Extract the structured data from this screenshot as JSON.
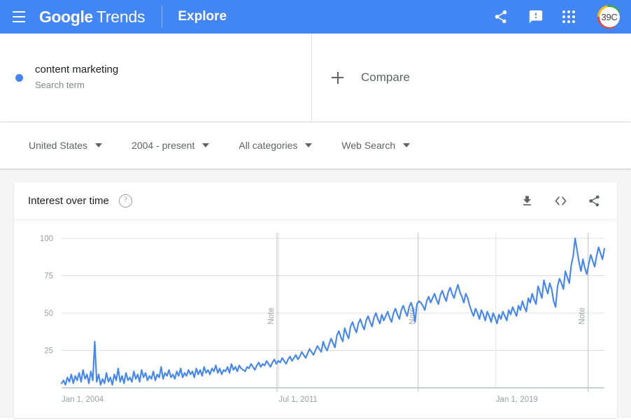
{
  "topbar": {
    "menu_icon": "hamburger-icon",
    "brand_google": "Google",
    "brand_product": "Trends",
    "explore_label": "Explore",
    "share_icon": "share-icon",
    "feedback_icon": "feedback-icon",
    "apps_icon": "apps-grid-icon",
    "avatar_text": "39C",
    "bg_color": "#4285F4"
  },
  "query": {
    "term_label": "content marketing",
    "term_type": "Search term",
    "term_color": "#4285F4",
    "compare_label": "Compare",
    "compare_icon": "plus-icon"
  },
  "filters": [
    {
      "label": "United States",
      "name": "location-filter"
    },
    {
      "label": "2004 - present",
      "name": "time-range-filter"
    },
    {
      "label": "All categories",
      "name": "category-filter"
    },
    {
      "label": "Web Search",
      "name": "search-type-filter"
    }
  ],
  "card": {
    "title": "Interest over time",
    "help_icon": "help-circle-icon",
    "help_glyph": "?",
    "download_icon": "download-icon",
    "embed_icon": "embed-code-icon",
    "share_icon": "share-icon"
  },
  "chart_data": {
    "type": "line",
    "title": "Interest over time",
    "xlabel": "",
    "ylabel": "",
    "ylim": [
      0,
      100
    ],
    "yticks": [
      100,
      75,
      50,
      25
    ],
    "grid": true,
    "legend": false,
    "line_color": "#4285F4",
    "xticks": [
      {
        "label": "Jan 1, 2004",
        "x_frac": 0.0
      },
      {
        "label": "Jul 1, 2011",
        "x_frac": 0.4
      },
      {
        "label": "Jan 1, 2019",
        "x_frac": 0.8
      }
    ],
    "annotations": [
      {
        "label": "Note",
        "x_frac": 0.397
      },
      {
        "label": "Note",
        "x_frac": 0.657
      },
      {
        "label": "Note",
        "x_frac": 0.97
      }
    ],
    "series": [
      {
        "name": "content marketing",
        "color": "#4285F4",
        "values": [
          3,
          5,
          2,
          7,
          4,
          9,
          3,
          8,
          5,
          10,
          4,
          12,
          6,
          9,
          3,
          11,
          5,
          31,
          4,
          9,
          2,
          6,
          3,
          10,
          4,
          7,
          2,
          9,
          5,
          13,
          4,
          8,
          3,
          10,
          5,
          7,
          4,
          11,
          6,
          9,
          4,
          12,
          7,
          10,
          5,
          8,
          6,
          11,
          5,
          9,
          7,
          14,
          6,
          10,
          8,
          12,
          7,
          9,
          6,
          11,
          8,
          13,
          7,
          10,
          8,
          12,
          9,
          11,
          7,
          13,
          9,
          12,
          8,
          14,
          10,
          12,
          9,
          13,
          11,
          15,
          10,
          13,
          9,
          12,
          11,
          14,
          10,
          16,
          12,
          14,
          11,
          15,
          13,
          12,
          11,
          14,
          13,
          16,
          14,
          12,
          15,
          17,
          14,
          16,
          15,
          18,
          16,
          14,
          17,
          19,
          16,
          18,
          17,
          20,
          18,
          16,
          19,
          21,
          18,
          20,
          22,
          19,
          21,
          24,
          22,
          20,
          23,
          26,
          24,
          22,
          25,
          28,
          26,
          24,
          31,
          27,
          25,
          29,
          33,
          30,
          27,
          35,
          38,
          34,
          31,
          40,
          36,
          33,
          41,
          44,
          40,
          37,
          43,
          46,
          42,
          39,
          45,
          48,
          44,
          41,
          47,
          50,
          46,
          43,
          49,
          45,
          48,
          51,
          47,
          44,
          50,
          53,
          49,
          46,
          52,
          55,
          51,
          48,
          54,
          57,
          53,
          44,
          56,
          58,
          57,
          55,
          52,
          58,
          61,
          57,
          60,
          63,
          59,
          56,
          62,
          65,
          61,
          58,
          64,
          67,
          63,
          60,
          65,
          69,
          64,
          61,
          57,
          63,
          60,
          55,
          51,
          48,
          53,
          50,
          46,
          52,
          49,
          45,
          51,
          48,
          44,
          50,
          47,
          43,
          49,
          46,
          51,
          48,
          45,
          52,
          49,
          54,
          51,
          48,
          55,
          52,
          58,
          54,
          51,
          60,
          57,
          63,
          59,
          56,
          68,
          64,
          60,
          72,
          67,
          63,
          70,
          66,
          58,
          54,
          68,
          73,
          70,
          66,
          78,
          74,
          70,
          82,
          88,
          100,
          92,
          84,
          78,
          86,
          80,
          76,
          83,
          89,
          85,
          81,
          88,
          94,
          90,
          86,
          93
        ]
      }
    ]
  }
}
